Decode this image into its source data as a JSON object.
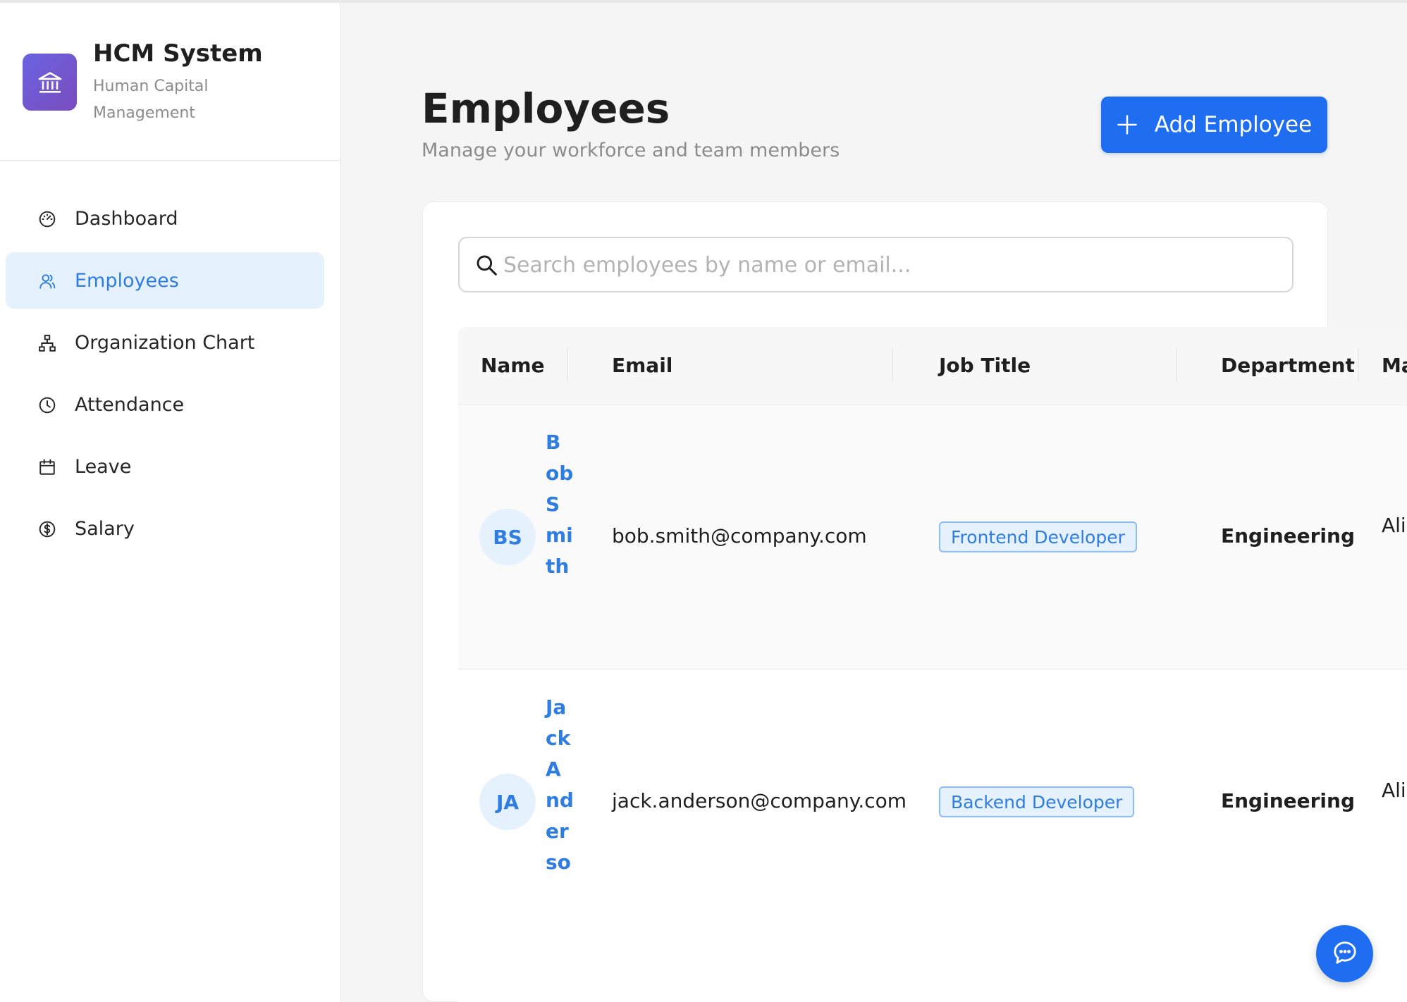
{
  "brand": {
    "title": "HCM System",
    "subtitle": "Human Capital Management",
    "icon": "bank-icon",
    "gradient_start": "#6b63e0",
    "gradient_end": "#7a4cbf"
  },
  "nav": {
    "items": [
      {
        "label": "Dashboard",
        "icon": "dashboard-icon"
      },
      {
        "label": "Employees",
        "icon": "users-icon",
        "active": true
      },
      {
        "label": "Organization Chart",
        "icon": "org-chart-icon"
      },
      {
        "label": "Attendance",
        "icon": "clock-icon"
      },
      {
        "label": "Leave",
        "icon": "calendar-icon"
      },
      {
        "label": "Salary",
        "icon": "dollar-icon"
      }
    ]
  },
  "header": {
    "title": "Employees",
    "subtitle": "Manage your workforce and team members",
    "add_button_label": "Add Employee"
  },
  "search": {
    "placeholder": "Search employees by name or email...",
    "value": ""
  },
  "table": {
    "columns": [
      "Name",
      "Email",
      "Job Title",
      "Department",
      "Ma"
    ],
    "rows": [
      {
        "initials": "BS",
        "name": "Bob Smith",
        "email": "bob.smith@company.com",
        "job_title": "Frontend Developer",
        "department": "Engineering",
        "manager": "Alic Joh"
      },
      {
        "initials": "JA",
        "name": "Jack Anderso",
        "email": "jack.anderson@company.com",
        "job_title": "Backend Developer",
        "department": "Engineering",
        "manager": "Alic Joh"
      }
    ]
  },
  "colors": {
    "accent": "#1f6df0",
    "link": "#2f7de1",
    "active_bg": "#e6f1fe"
  }
}
